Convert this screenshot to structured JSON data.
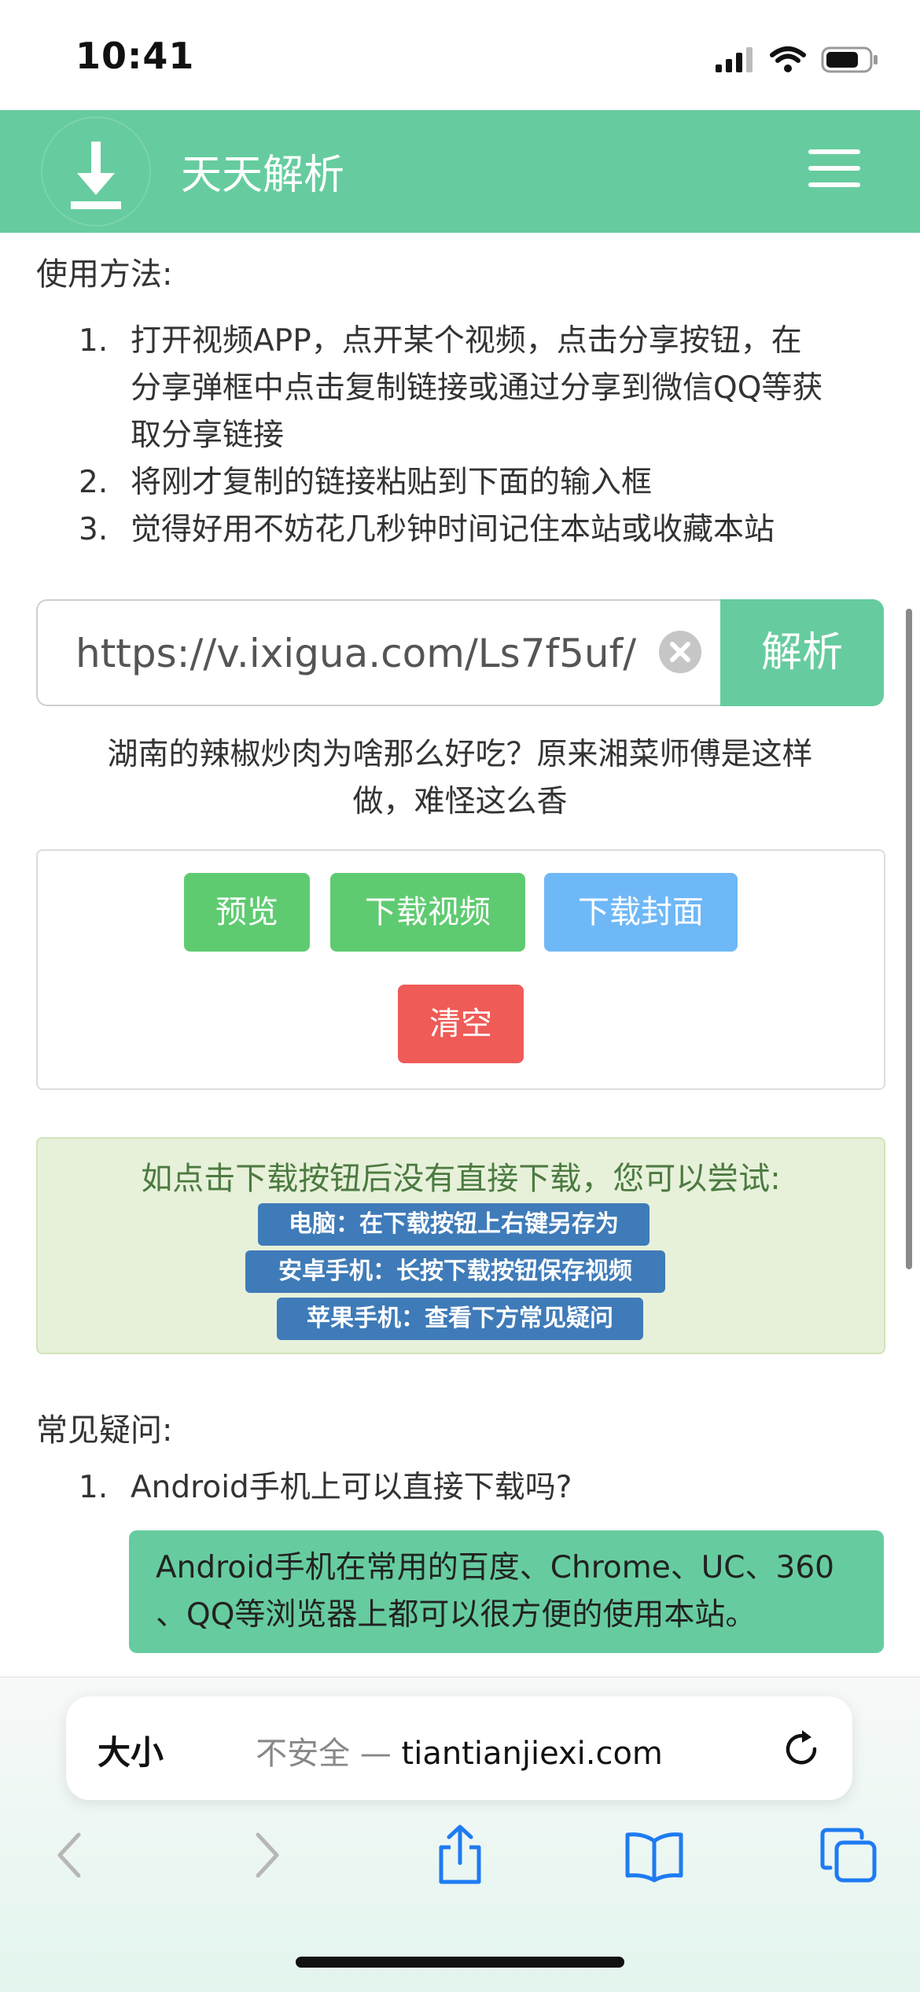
{
  "status_bar": {
    "time": "10:41"
  },
  "header": {
    "brand": "天天解析"
  },
  "usage": {
    "title": "使用方法:",
    "steps": [
      {
        "num": "1.",
        "lines": [
          "打开视频APP，点开某个视频，点击分享按钮，在",
          "分享弹框中点击复制链接或通过分享到微信QQ等获",
          "取分享链接"
        ]
      },
      {
        "num": "2.",
        "lines": [
          "将刚才复制的链接粘贴到下面的输入框"
        ]
      },
      {
        "num": "3.",
        "lines": [
          "觉得好用不妨花几秒钟时间记住本站或收藏本站"
        ]
      }
    ]
  },
  "input": {
    "value": "https://v.ixigua.com/Ls7f5uf/",
    "parse_label": "解析"
  },
  "video_title": {
    "line1": "湖南的辣椒炒肉为啥那么好吃？原来湘菜师傅是这样",
    "line2": "做，难怪这么香"
  },
  "actions": {
    "preview": "预览",
    "download_video": "下载视频",
    "download_cover": "下载封面",
    "clear": "清空"
  },
  "tips": {
    "title": "如点击下载按钮后没有直接下载，您可以尝试:",
    "pc": "电脑：在下载按钮上右键另存为",
    "android": "安卓手机：长按下载按钮保存视频",
    "apple": "苹果手机：查看下方常见疑问"
  },
  "faq": {
    "title": "常见疑问:",
    "q1_num": "1.",
    "q1": "Android手机上可以直接下载吗?",
    "a1_line1": "Android手机在常用的百度、Chrome、UC、360",
    "a1_line2": "、QQ等浏览器上都可以很方便的使用本站。"
  },
  "browser": {
    "text_size": "大小",
    "insecure": "不安全 — ",
    "domain": "tiantianjiexi.com"
  },
  "colors": {
    "brand_green": "#66cc9f",
    "preview_green": "#5fcb71",
    "cover_blue": "#6fb8f7",
    "clear_red": "#ef5b56",
    "tag_blue": "#3f7bb8"
  }
}
